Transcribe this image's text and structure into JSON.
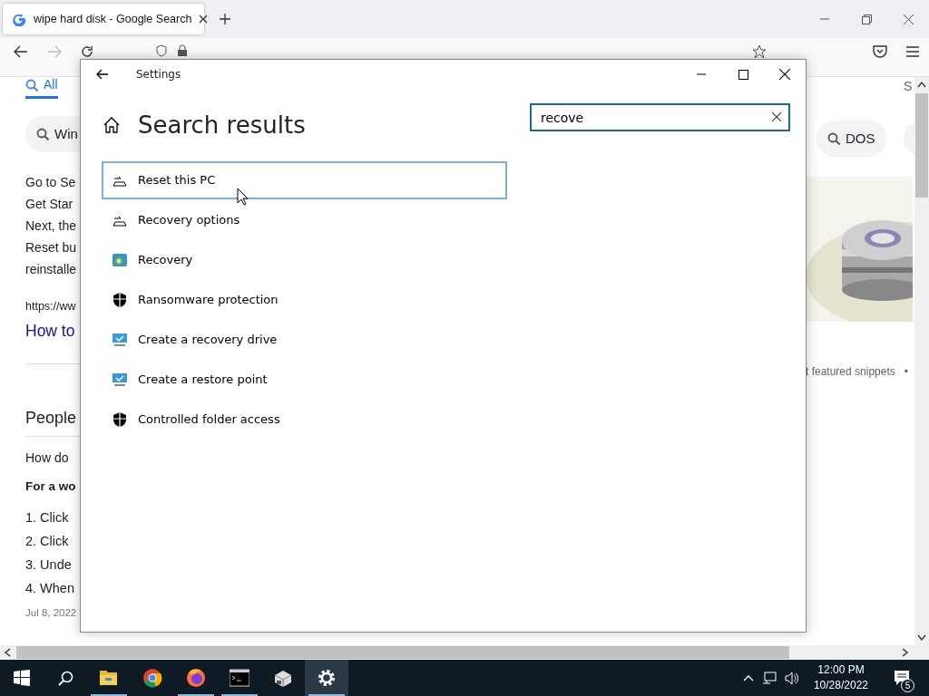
{
  "browser": {
    "tab": {
      "title": "wipe hard disk - Google Search"
    },
    "left": {
      "all_tab": "All",
      "chip": "Win",
      "snippet_lines": [
        "Go to Se",
        "Get Star",
        "Next, the",
        "Reset bu",
        "reinstalle"
      ],
      "source_url": "https://ww",
      "link": "How to",
      "heading": "People",
      "question": "How do",
      "answer_title": "For a wo",
      "steps": [
        "1. Click",
        "2. Click",
        "3. Unde",
        "4. When"
      ],
      "date": "Jul 8, 2022"
    },
    "right": {
      "tab_text": "S",
      "chip": "DOS",
      "snippet_note": "t featured snippets",
      "dot": "•"
    }
  },
  "settings": {
    "title": "Settings",
    "heading": "Search results",
    "search": {
      "value": "recove"
    },
    "results": [
      {
        "label": "Reset this PC",
        "kind": "reset",
        "selected": true
      },
      {
        "label": "Recovery options",
        "kind": "reset",
        "selected": false
      },
      {
        "label": "Recovery",
        "kind": "recovery",
        "selected": false
      },
      {
        "label": "Ransomware protection",
        "kind": "shield",
        "selected": false
      },
      {
        "label": "Create a recovery drive",
        "kind": "monitor",
        "selected": false
      },
      {
        "label": "Create a restore point",
        "kind": "monitor",
        "selected": false
      },
      {
        "label": "Controlled folder access",
        "kind": "shield",
        "selected": false
      }
    ]
  },
  "taskbar": {
    "apps": [
      {
        "kind": "explorer",
        "running": true,
        "active": false
      },
      {
        "kind": "chrome",
        "running": false,
        "active": false
      },
      {
        "kind": "firefox",
        "running": true,
        "active": false
      },
      {
        "kind": "terminal",
        "running": true,
        "active": false
      },
      {
        "kind": "package",
        "running": false,
        "active": false
      },
      {
        "kind": "settings",
        "running": true,
        "active": true
      }
    ],
    "time": "12:00 PM",
    "date": "10/28/2022",
    "notifications": "5"
  }
}
